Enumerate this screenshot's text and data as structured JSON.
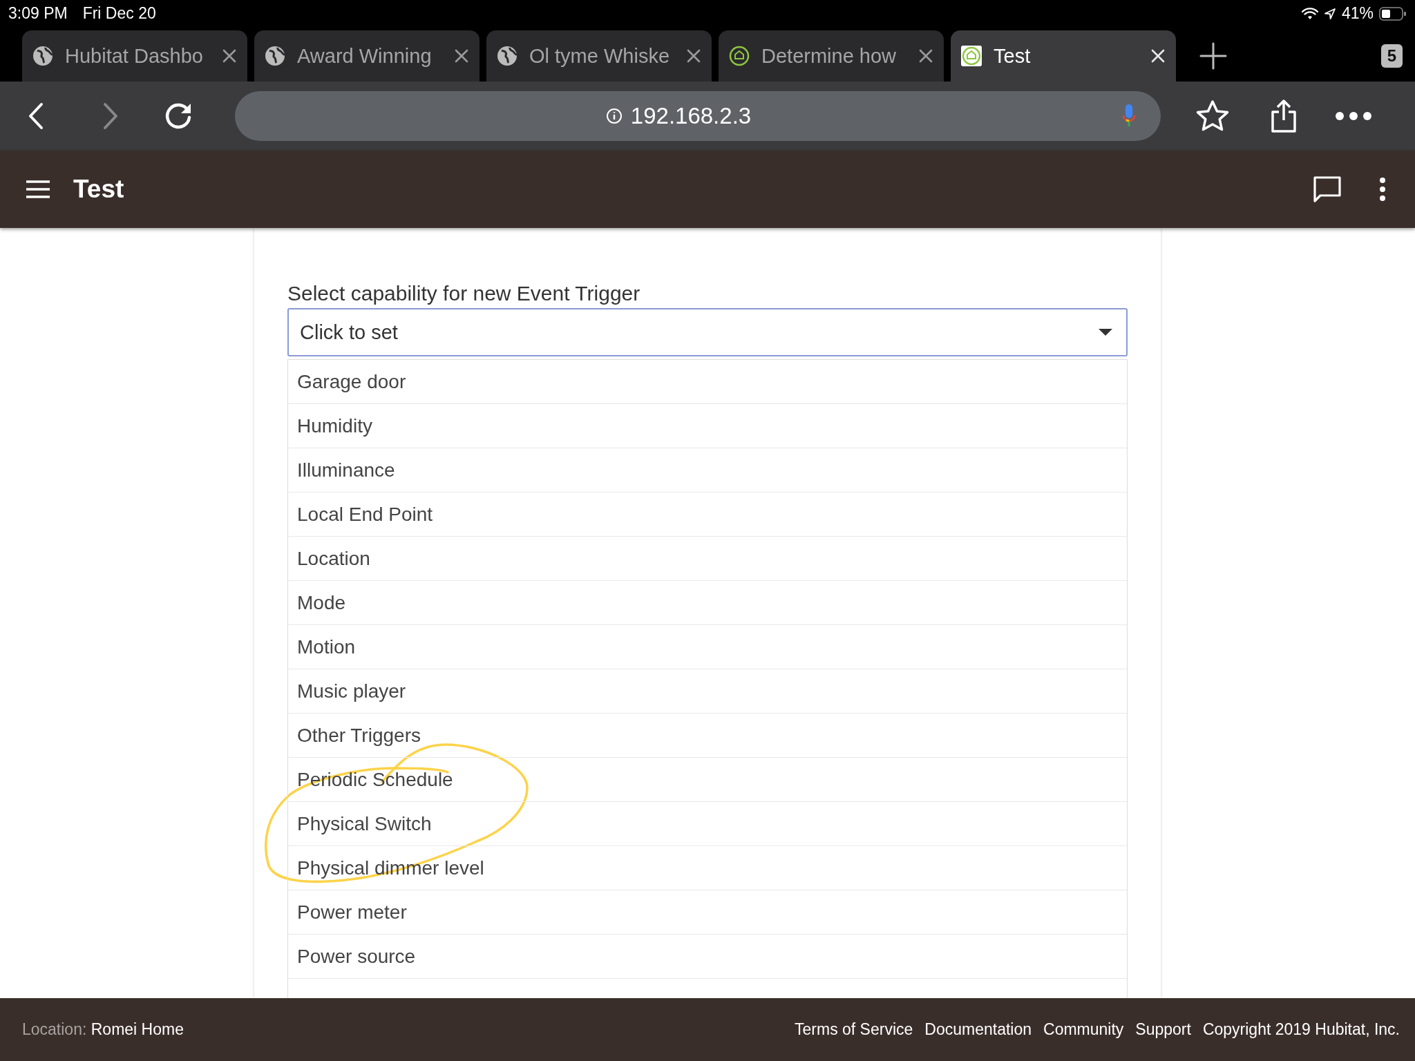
{
  "status_bar": {
    "time": "3:09 PM",
    "date": "Fri Dec 20",
    "battery": "41%"
  },
  "browser": {
    "tabs": [
      {
        "title": "Hubitat Dashbo",
        "kind": "globe",
        "selected": false
      },
      {
        "title": "Award Winning",
        "kind": "globe",
        "selected": false
      },
      {
        "title": "Ol tyme Whiske",
        "kind": "globe",
        "selected": false
      },
      {
        "title": "Determine how",
        "kind": "house",
        "selected": false
      },
      {
        "title": "Test",
        "kind": "house",
        "selected": true
      }
    ],
    "tab_count": "5",
    "url": "192.168.2.3"
  },
  "app_bar": {
    "title": "Test"
  },
  "form": {
    "label": "Select capability for new Event Trigger",
    "select": {
      "value": "Click to set",
      "expanded": true
    },
    "options": [
      "Garage door",
      "Humidity",
      "Illuminance",
      "Local End Point",
      "Location",
      "Mode",
      "Motion",
      "Music player",
      "Other Triggers",
      "Periodic Schedule",
      "Physical Switch",
      "Physical dimmer level",
      "Power meter",
      "Power source"
    ]
  },
  "footer": {
    "location_label": "Location:",
    "location": "Romei Home",
    "links": [
      "Terms of Service",
      "Documentation",
      "Community",
      "Support",
      "Copyright 2019 Hubitat, Inc."
    ]
  }
}
